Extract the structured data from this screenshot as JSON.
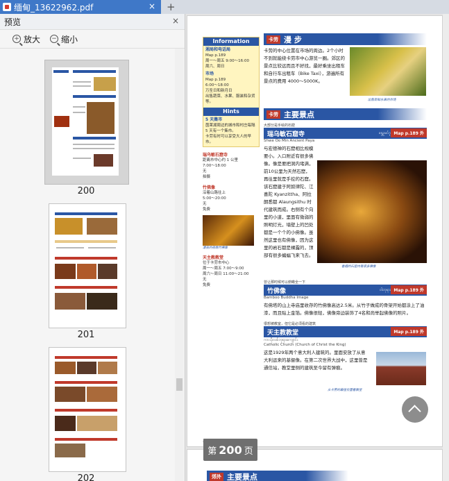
{
  "tab": {
    "title": "缅甸_13622962.pdf",
    "close": "×",
    "new_tab": "+"
  },
  "sidebar": {
    "title": "预览",
    "close": "×",
    "zoom_in": "放大",
    "zoom_out": "缩小",
    "thumbnails": [
      {
        "label": "200"
      },
      {
        "label": "201"
      },
      {
        "label": "202"
      }
    ]
  },
  "doc": {
    "info_title": "Information",
    "info_lines": [
      "湘局和电话局",
      "Map p.189",
      "周一～周五 9:00～16:00",
      "周六、周日",
      "市场",
      "Map p.189",
      "6:00～18:00",
      "万圣日和新月日",
      "出售蔬菜、水果、服装和杂货等。"
    ],
    "hints_title": "Hints",
    "hints_lines": [
      "5 天集市",
      "茵莱湖周边的城市和村庄每隔 5 天有一个集市。",
      "卡劳有时可以享受大人的早市。"
    ],
    "left_sights": [
      {
        "title": "瑞乌敏石窟寺",
        "lines": [
          "距离市中心约 1 公里",
          "7:00～18:00",
          "无",
          "拍摄"
        ]
      },
      {
        "title": "竹佛像",
        "lines": [
          "沿着山路往上",
          "5:00～20:00",
          "无",
          "免费"
        ]
      }
    ],
    "left_caption": "漂亮的夜晚竹佛像",
    "left_sight3": {
      "title": "天主教教堂",
      "lines": [
        "位于卡劳市中心",
        "周一～周五 7:00～9:00",
        "周六～周日 11:00～21:00",
        "无",
        "免费"
      ]
    },
    "main": {
      "walk_tag": "卡劳",
      "walk_title": "漫 步",
      "walk_text": "卡劳的中心位置在市场的周边。2个小时不到就能绕卡劳市中心游览一圈。郊区的景点比较远而且不好找，最好乘坐出租车和自行车出租车（Bike Taxi），游遍所有景点的费用 4000～5000K。",
      "walk_caption": "出售新鲜水果的市场",
      "sights_tag": "卡劳",
      "sights_title": "主要景点",
      "sights": [
        {
          "sub": "大部分是手绘的石窟",
          "title": "瑞乌敏石窟寺",
          "burmese": "ရွှေဥမင်ဂူ",
          "en": "Shwe Oo Min Ancient Paya",
          "map": "Map p.189 外",
          "text": "与宏德禅的石窟相比规模要小。入口附近有很多佛像。像是要把洞内堵满，前10公里为天然石窟，再往里就是手挖的石窟。该石窟建于阿奴律陀、江喜陀 Kyanzittha、阿拉朗悉都 Alaungsithu 时代建筑而成。右侧有个向里的小道，里面有微弱的照明灯光，墙壁上的凹处都是一个个的小佛像。虽然这里也有佛像，因为这里的岩石都是裸露的，顶部有很多蝙蝠飞来飞去。",
          "caption": "香烟的石窟内有很多佛像"
        },
        {
          "sub": "曾让那时候可以俯瞰全一下",
          "title": "竹佛像",
          "burmese": "ဝါးဘုရား",
          "en": "Bamboo Buddha Image",
          "map": "Map p.189 外",
          "text": "有佛塔的山上寺庙里收存的竹佛像高达2.5米。从竹子做成的骨架开始都涂上了油漆，而且贴上金箔。佛像很轻，佛像旁边装饰了4名和尚举起佛像的照片。"
        },
        {
          "sub": "很想被教室，但它是必须看的建筑",
          "title": "天主教教堂",
          "burmese": "ကာသိုလစ်ဘုရားကျောင်း",
          "en": "Catholic Church (Church of Christ the King)",
          "map": "Map p.189 外",
          "text": "这是1929年两个意大利人建筑的。里面安放了从意大利运来的基督像。在第二次世界大战中，这里曾是通信站，教堂里侧的建筑至今留有弹痕。",
          "caption": "从卡劳的最佳位置看教堂"
        }
      ]
    },
    "page_number": "190",
    "next_page_tag": "郊外",
    "next_page_title": "主要景点"
  },
  "page_badge": {
    "prefix": "第",
    "number": "200",
    "suffix": "页"
  },
  "colors": {
    "accent": "#3f78c8",
    "band": "#2a56a4",
    "tag": "#c0392b"
  }
}
